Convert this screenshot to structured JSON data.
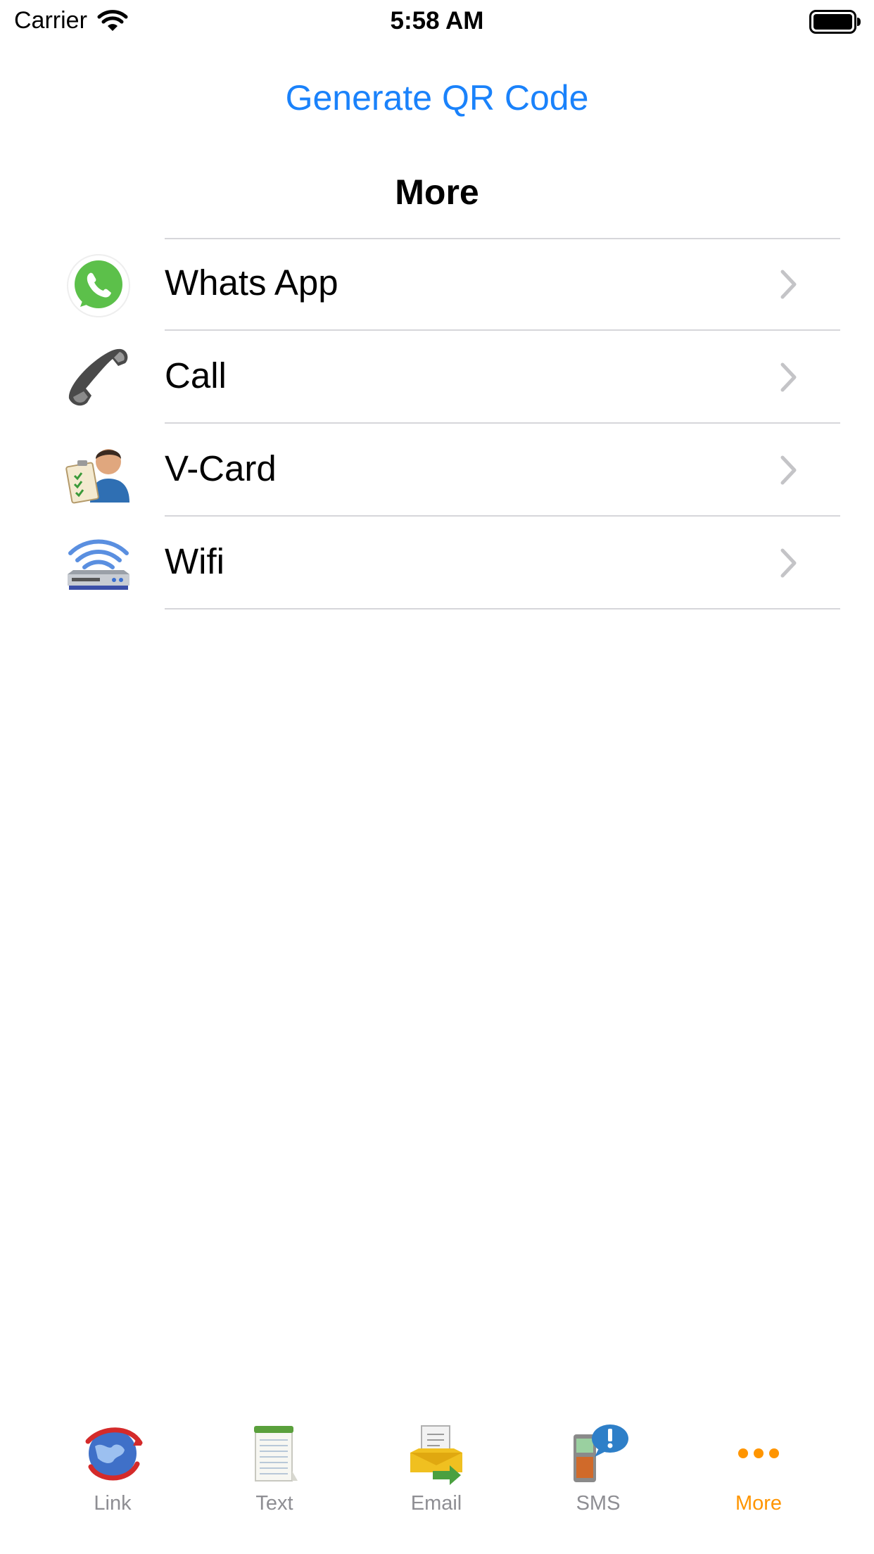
{
  "status_bar": {
    "carrier": "Carrier",
    "time": "5:58 AM"
  },
  "header": {
    "generate_label": "Generate QR Code",
    "section_title": "More"
  },
  "list": {
    "items": [
      {
        "label": "Whats App",
        "icon": "whatsapp-icon"
      },
      {
        "label": "Call",
        "icon": "phone-icon"
      },
      {
        "label": "V-Card",
        "icon": "vcard-icon"
      },
      {
        "label": "Wifi",
        "icon": "wifi-router-icon"
      }
    ]
  },
  "tab_bar": {
    "tabs": [
      {
        "label": "Link",
        "icon": "globe-link-icon"
      },
      {
        "label": "Text",
        "icon": "notepad-icon"
      },
      {
        "label": "Email",
        "icon": "email-icon"
      },
      {
        "label": "SMS",
        "icon": "sms-phone-icon"
      },
      {
        "label": "More",
        "icon": "more-dots-icon",
        "active": true
      }
    ]
  },
  "colors": {
    "link": "#1a82fb",
    "active_tab": "#ff9500",
    "inactive_tab": "#8e8e93",
    "separator": "#d6d6da"
  }
}
